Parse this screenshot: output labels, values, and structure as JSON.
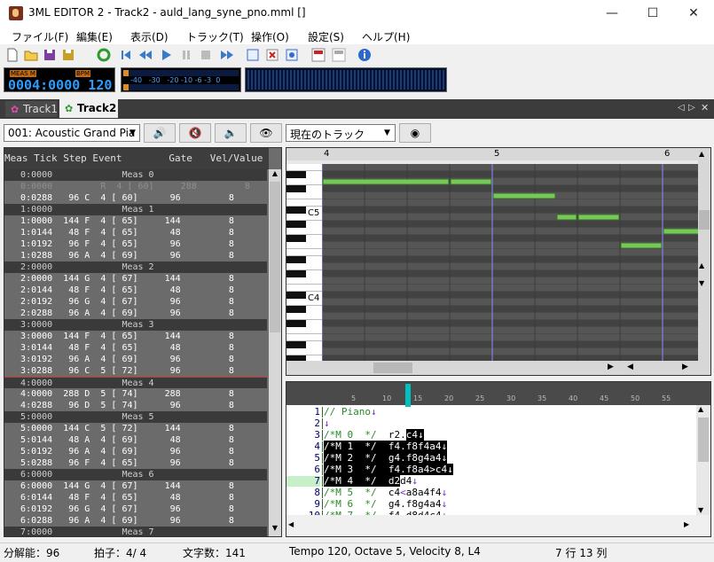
{
  "window": {
    "title": "3ML EDITOR 2 - Track2 - auld_lang_syne_pno.mml []",
    "minimize": "—",
    "maximize": "☐",
    "close": "✕"
  },
  "menu": [
    "ファイル(F)",
    "編集(E)",
    "表示(D)",
    "トラック(T)",
    "操作(O)",
    "設定(S)",
    "ヘルプ(H)"
  ],
  "meter": {
    "label_meas": "MEAS M",
    "label_bpm": "BPM",
    "value": "0004:0000 120"
  },
  "level_scale": "-40   -30   -20 -10 -6 -3  0",
  "tabs": [
    {
      "label": "Track1"
    },
    {
      "label": "Track2"
    }
  ],
  "instrument": "001: Acoustic Grand Pia",
  "track_select": "現在のトラック",
  "event_list": {
    "header": "Meas Tick Step Event        Gate   Vel/Value",
    "rows": [
      {
        "kind": "meas",
        "text": "   0:0000             Meas 0"
      },
      {
        "kind": "ev",
        "text": "   0:0000         R  4 [ 60]     288         8",
        "dim": true
      },
      {
        "kind": "ev",
        "text": "   0:0288   96 C  4 [ 60]      96         8"
      },
      {
        "kind": "meas",
        "text": "   1:0000             Meas 1"
      },
      {
        "kind": "ev",
        "text": "   1:0000  144 F  4 [ 65]     144         8"
      },
      {
        "kind": "ev",
        "text": "   1:0144   48 F  4 [ 65]      48         8"
      },
      {
        "kind": "ev",
        "text": "   1:0192   96 F  4 [ 65]      96         8"
      },
      {
        "kind": "ev",
        "text": "   1:0288   96 A  4 [ 69]      96         8"
      },
      {
        "kind": "meas",
        "text": "   2:0000             Meas 2"
      },
      {
        "kind": "ev",
        "text": "   2:0000  144 G  4 [ 67]     144         8"
      },
      {
        "kind": "ev",
        "text": "   2:0144   48 F  4 [ 65]      48         8"
      },
      {
        "kind": "ev",
        "text": "   2:0192   96 G  4 [ 67]      96         8"
      },
      {
        "kind": "ev",
        "text": "   2:0288   96 A  4 [ 69]      96         8"
      },
      {
        "kind": "meas",
        "text": "   3:0000             Meas 3"
      },
      {
        "kind": "ev",
        "text": "   3:0000  144 F  4 [ 65]     144         8"
      },
      {
        "kind": "ev",
        "text": "   3:0144   48 F  4 [ 65]      48         8"
      },
      {
        "kind": "ev",
        "text": "   3:0192   96 A  4 [ 69]      96         8"
      },
      {
        "kind": "ev",
        "text": "   3:0288   96 C  5 [ 72]      96         8"
      },
      {
        "kind": "meas",
        "text": "   4:0000             Meas 4",
        "current": true
      },
      {
        "kind": "ev",
        "text": "   4:0000  288 D  5 [ 74]     288         8"
      },
      {
        "kind": "ev",
        "text": "   4:0288   96 D  5 [ 74]      96         8"
      },
      {
        "kind": "meas",
        "text": "   5:0000             Meas 5"
      },
      {
        "kind": "ev",
        "text": "   5:0000  144 C  5 [ 72]     144         8"
      },
      {
        "kind": "ev",
        "text": "   5:0144   48 A  4 [ 69]      48         8"
      },
      {
        "kind": "ev",
        "text": "   5:0192   96 A  4 [ 69]      96         8"
      },
      {
        "kind": "ev",
        "text": "   5:0288   96 F  4 [ 65]      96         8"
      },
      {
        "kind": "meas",
        "text": "   6:0000             Meas 6"
      },
      {
        "kind": "ev",
        "text": "   6:0000  144 G  4 [ 67]     144         8"
      },
      {
        "kind": "ev",
        "text": "   6:0144   48 F  4 [ 65]      48         8"
      },
      {
        "kind": "ev",
        "text": "   6:0192   96 G  4 [ 67]      96         8"
      },
      {
        "kind": "ev",
        "text": "   6:0288   96 A  4 [ 69]      96         8"
      },
      {
        "kind": "meas",
        "text": "   7:0000             Meas 7"
      }
    ]
  },
  "pianoroll": {
    "measures": [
      "4",
      "5",
      "6"
    ],
    "key_labels": [
      "C5",
      "C4"
    ]
  },
  "mml": {
    "ruler": [
      "5",
      "10",
      "15",
      "20",
      "25",
      "30",
      "35",
      "40",
      "45",
      "50",
      "55"
    ],
    "lines": [
      {
        "n": "1",
        "parts": [
          {
            "t": "// Piano",
            "c": "cmt"
          },
          {
            "t": "↓",
            "c": "arr"
          }
        ]
      },
      {
        "n": "2",
        "parts": [
          {
            "t": "↓",
            "c": "arr"
          }
        ]
      },
      {
        "n": "3",
        "parts": [
          {
            "t": "/*M 0  */",
            "c": "cmt"
          },
          {
            "t": "  r2."
          },
          {
            "t": "c4",
            "c": "sel"
          },
          {
            "t": "↓",
            "c": "sel"
          }
        ]
      },
      {
        "n": "4",
        "parts": [
          {
            "t": "/*M 1  */",
            "c": "sel"
          },
          {
            "t": "  f4.f8f4a4",
            "c": "sel"
          },
          {
            "t": "↓",
            "c": "sel"
          }
        ]
      },
      {
        "n": "5",
        "parts": [
          {
            "t": "/*M 2  */",
            "c": "sel"
          },
          {
            "t": "  g4.f8g4a4",
            "c": "sel"
          },
          {
            "t": "↓",
            "c": "sel"
          }
        ]
      },
      {
        "n": "6",
        "parts": [
          {
            "t": "/*M 3  */",
            "c": "sel"
          },
          {
            "t": "  f4.f8a4>c4",
            "c": "sel"
          },
          {
            "t": "↓",
            "c": "sel"
          }
        ]
      },
      {
        "n": "7",
        "parts": [
          {
            "t": "/*M 4  */",
            "c": "sel"
          },
          {
            "t": "  d2",
            "c": "sel"
          },
          {
            "t": "d4"
          },
          {
            "t": "↓",
            "c": "arr"
          }
        ]
      },
      {
        "n": "8",
        "parts": [
          {
            "t": "/*M 5  */",
            "c": "cmt"
          },
          {
            "t": "  c4"
          },
          {
            "t": "<",
            "c": "arr"
          },
          {
            "t": "a8a4f4"
          },
          {
            "t": "↓",
            "c": "arr"
          }
        ]
      },
      {
        "n": "9",
        "parts": [
          {
            "t": "/*M 6  */",
            "c": "cmt"
          },
          {
            "t": "  g4.f8g4a4"
          },
          {
            "t": "↓",
            "c": "arr"
          }
        ]
      },
      {
        "n": "10",
        "parts": [
          {
            "t": "/*M 7  */",
            "c": "cmt"
          },
          {
            "t": "  f4.d8d4c4"
          },
          {
            "t": "↓",
            "c": "arr"
          }
        ]
      }
    ]
  },
  "status": {
    "resolution": "分解能：96",
    "beat": "拍子：4/ 4",
    "chars": "文字数：141",
    "info": "Tempo 120, Octave 5, Velocity  8, L4",
    "cursor": "7 行 13 列"
  },
  "colors": {
    "note": "#76c85a",
    "selection": "#000000",
    "comment": "#2a8a2a",
    "playhead": "#00c0c0",
    "current_line": "#c8f0c8"
  },
  "icons": {
    "toolbar": [
      "new-file-icon",
      "open-folder-icon",
      "save-icon",
      "save-as-icon",
      "refresh-icon",
      "rewind-start-icon",
      "rewind-icon",
      "play-icon",
      "pause-icon",
      "stop-icon",
      "fast-forward-icon",
      "new-track-icon",
      "delete-track-icon",
      "track-settings-icon",
      "mml-export-icon",
      "mml-import-icon",
      "info-icon"
    ]
  }
}
